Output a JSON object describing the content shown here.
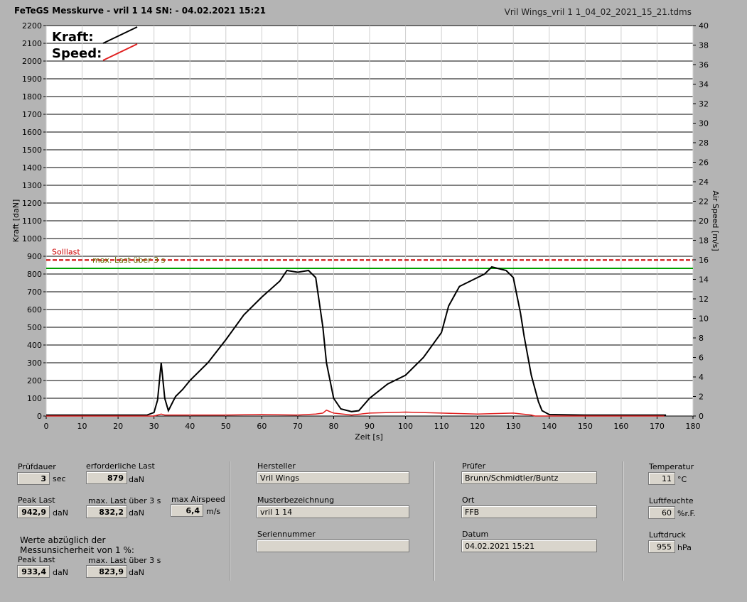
{
  "header": {
    "title": "FeTeGS Messkurve - vril 1 14  SN:  - 04.02.2021 15:21",
    "filename": "Vril Wings_vril 1 1_04_02_2021_15_21.tdms"
  },
  "colors": {
    "kraft": "#000000",
    "speed": "#e02020",
    "sollLine": "#cc0000",
    "maxLine": "#00a000"
  },
  "chart_data": {
    "type": "line",
    "xlabel": "Zeit [s]",
    "ylabel": "Kraft [daN]",
    "y2label": "Air Speed [m/s]",
    "xlim": [
      0,
      180
    ],
    "ylim": [
      0,
      2200
    ],
    "y2lim": [
      0,
      40
    ],
    "x_ticks": [
      0,
      10,
      20,
      30,
      40,
      50,
      60,
      70,
      80,
      90,
      100,
      110,
      120,
      130,
      140,
      150,
      160,
      170,
      180
    ],
    "y_ticks": [
      0,
      100,
      200,
      300,
      400,
      500,
      600,
      700,
      800,
      900,
      1000,
      1100,
      1200,
      1300,
      1400,
      1500,
      1600,
      1700,
      1800,
      1900,
      2000,
      2100,
      2200
    ],
    "y2_ticks": [
      0,
      2,
      4,
      6,
      8,
      10,
      12,
      14,
      16,
      18,
      20,
      22,
      24,
      26,
      28,
      30,
      32,
      34,
      36,
      38,
      40
    ],
    "legend": {
      "kraft": "Kraft:",
      "speed": "Speed:"
    },
    "annotations": {
      "soll_label": "Solllast",
      "soll_value": 879,
      "max_label": "max. Last über  3 s",
      "max_value": 832
    },
    "series": [
      {
        "name": "Kraft",
        "color": "#000000",
        "x": [
          0,
          10,
          20,
          28,
          30,
          31,
          32,
          33,
          34,
          35,
          36,
          38,
          40,
          45,
          50,
          55,
          60,
          65,
          67,
          70,
          73,
          75,
          77,
          78,
          80,
          82,
          85,
          87,
          90,
          95,
          100,
          105,
          110,
          112,
          115,
          118,
          120,
          122,
          124,
          126,
          128,
          130,
          132,
          133,
          135,
          137,
          138,
          140,
          150,
          160,
          170,
          172.5
        ],
        "y": [
          5,
          5,
          5,
          5,
          20,
          90,
          300,
          100,
          30,
          70,
          110,
          150,
          200,
          300,
          430,
          570,
          670,
          760,
          820,
          810,
          820,
          780,
          500,
          300,
          100,
          40,
          25,
          30,
          100,
          180,
          230,
          330,
          470,
          620,
          730,
          760,
          780,
          800,
          840,
          830,
          820,
          780,
          580,
          450,
          230,
          80,
          30,
          8,
          5,
          5,
          5,
          5
        ]
      },
      {
        "name": "Speed",
        "color": "#e02020",
        "x": [
          0,
          30,
          31,
          32,
          33,
          40,
          50,
          60,
          70,
          75,
          77,
          78,
          80,
          85,
          90,
          100,
          110,
          120,
          130,
          135,
          136,
          140,
          172
        ],
        "y": [
          0,
          0,
          0.1,
          0.2,
          0.1,
          0.1,
          0.1,
          0.15,
          0.1,
          0.2,
          0.3,
          0.6,
          0.3,
          0.1,
          0.3,
          0.4,
          0.3,
          0.2,
          0.3,
          0.1,
          0,
          0,
          0
        ]
      }
    ]
  },
  "fields": {
    "pruefdauer": {
      "label": "Prüfdauer",
      "value": "3",
      "unit": "sec"
    },
    "erf_last": {
      "label": "erforderliche Last",
      "value": "879",
      "unit": "daN"
    },
    "peak_last": {
      "label": "Peak Last",
      "value": "942,9",
      "unit": "daN"
    },
    "max_last": {
      "label": "max. Last über  3 s",
      "value": "832,2",
      "unit": "daN"
    },
    "max_airspeed": {
      "label": "max Airspeed",
      "value": "6,4",
      "unit": "m/s"
    },
    "werte_text1": "Werte abzüglich der",
    "werte_text2": "Messunsicherheit von 1  %:",
    "peak_last2": {
      "label": "Peak Last",
      "value": "933,4",
      "unit": "daN"
    },
    "max_last2": {
      "label": "max. Last über  3 s",
      "value": "823,9",
      "unit": "daN"
    },
    "hersteller": {
      "label": "Hersteller",
      "value": "Vril Wings"
    },
    "muster": {
      "label": "Musterbezeichnung",
      "value": "vril 1 14"
    },
    "serien": {
      "label": "Seriennummer",
      "value": ""
    },
    "pruefer": {
      "label": "Prüfer",
      "value": "Brunn/Schmidtler/Buntz"
    },
    "ort": {
      "label": "Ort",
      "value": "FFB"
    },
    "datum": {
      "label": "Datum",
      "value": "04.02.2021 15:21"
    },
    "temperatur": {
      "label": "Temperatur",
      "value": "11",
      "unit": "°C"
    },
    "luftfeuchte": {
      "label": "Luftfeuchte",
      "value": "60",
      "unit": "%r.F."
    },
    "luftdruck": {
      "label": "Luftdruck",
      "value": "955",
      "unit": "hPa"
    }
  }
}
